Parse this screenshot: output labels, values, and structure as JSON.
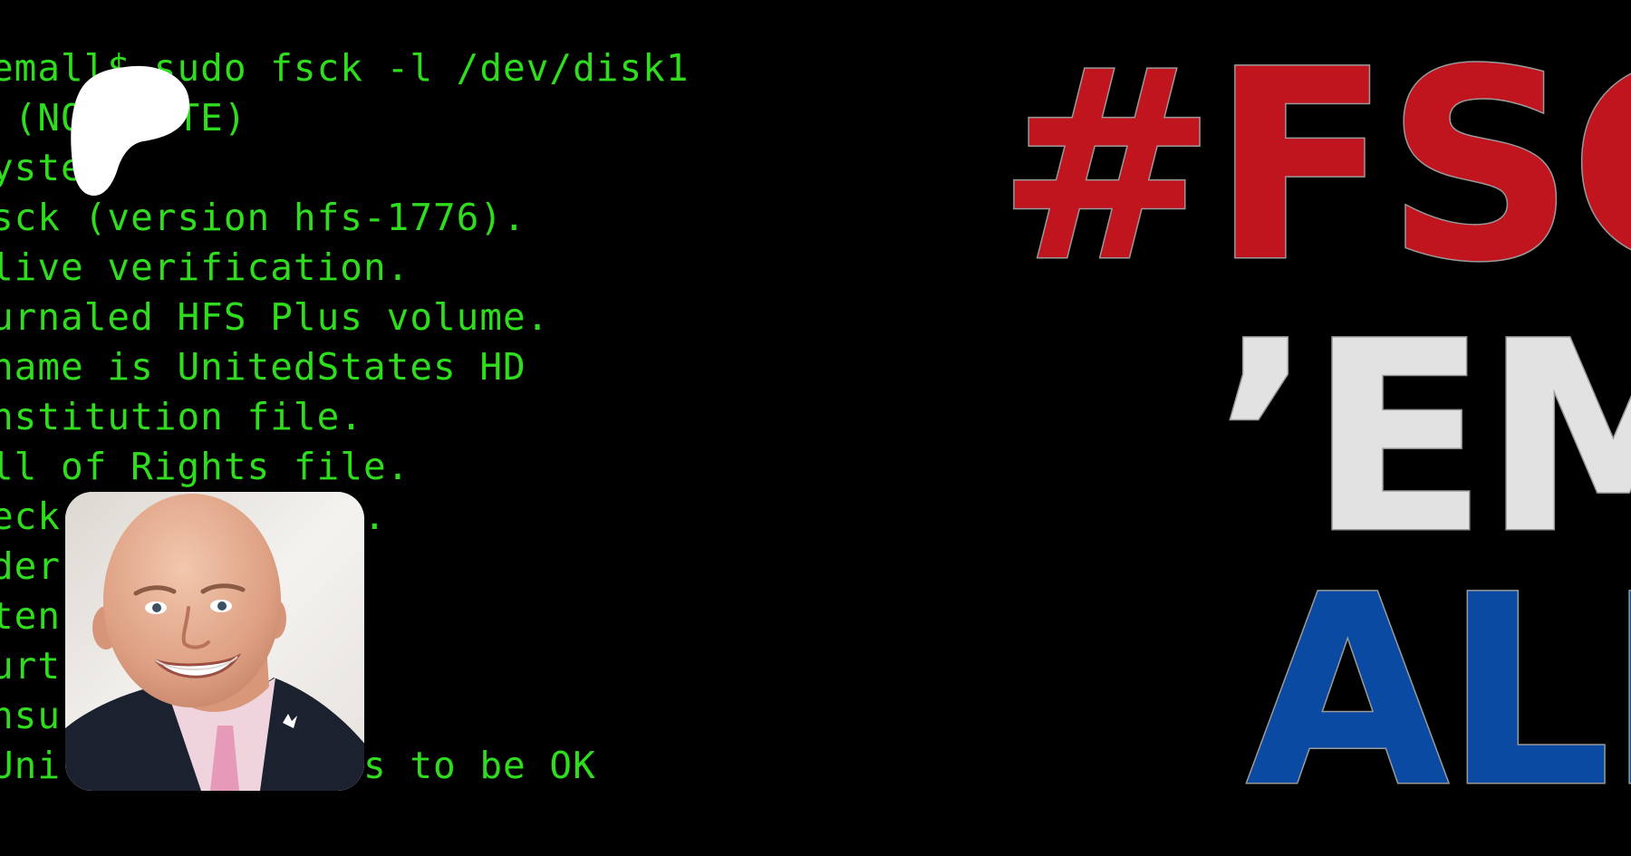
{
  "terminal": {
    "lines": [
      "emall$ sudo fsck -l /dev/disk1",
      " (NO WRITE)",
      "ystem",
      "sck (version hfs-1776).",
      "live verification.",
      "urnaled HFS Plus volume.",
      "name is UnitedStates HD",
      "nstitution file.",
      "ll of Rights file.",
      "eck     es files.",
      "der      chy.",
      "ten      file.",
      "urt",
      "nsu      n.",
      "Uni       appears to be OK"
    ]
  },
  "headline": {
    "line1": "#FSC",
    "line2": "’EM",
    "line3": "ALL",
    "colors": {
      "line1": "#c0141f",
      "line2": "#e2e2e2",
      "line3": "#0b4aa2",
      "background": "#000000",
      "terminal_text": "#2fdc1e"
    }
  },
  "icons": {
    "logo": "creator-logo-icon",
    "avatar": "profile-photo"
  }
}
